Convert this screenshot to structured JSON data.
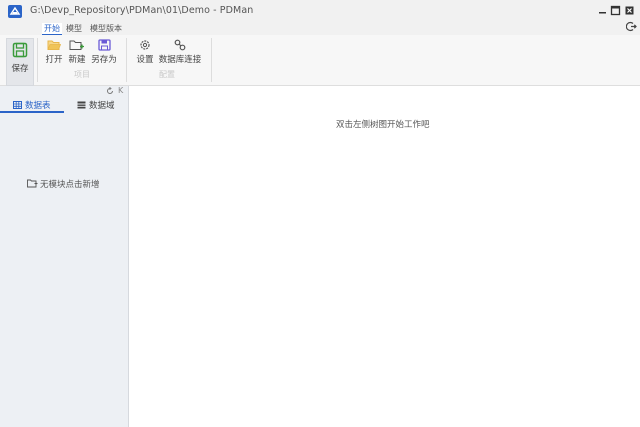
{
  "window": {
    "title": "G:\\Devp_Repository\\PDMan\\01\\Demo - PDMan",
    "logo_icon": "pdman-logo",
    "controls": [
      "minimize-icon",
      "maximize-icon",
      "close-icon"
    ],
    "extra_icon": "logout-icon"
  },
  "menu": {
    "tabs": [
      "开始",
      "模型",
      "模型版本"
    ],
    "active": 0
  },
  "ribbon": {
    "save": {
      "label": "保存",
      "icon": "save-icon"
    },
    "open": {
      "label": "打开",
      "icon": "folder-open-icon"
    },
    "new": {
      "label": "新建",
      "icon": "folder-new-icon"
    },
    "save_as": {
      "label": "另存为",
      "icon": "save-as-icon"
    },
    "project_group": "项目",
    "settings": {
      "label": "设置",
      "icon": "gear-icon"
    },
    "db_connect": {
      "label": "数据库连接",
      "icon": "link-icon"
    },
    "config_group": "配置"
  },
  "sidebar": {
    "refresh_icon": "refresh-icon",
    "collapse_label": "K",
    "tabs": [
      {
        "label": "数据表",
        "icon": "table-icon"
      },
      {
        "label": "数据域",
        "icon": "list-icon"
      }
    ],
    "empty_text": "无模块点击新增",
    "empty_icon": "folder-add-icon"
  },
  "main": {
    "hint": "双击左侧树图开始工作吧"
  },
  "colors": {
    "accent": "#2b64c8",
    "save_green": "#3a9b3a",
    "folder_yellow": "#e8b64a",
    "save_as_purple": "#6b5bd6"
  }
}
